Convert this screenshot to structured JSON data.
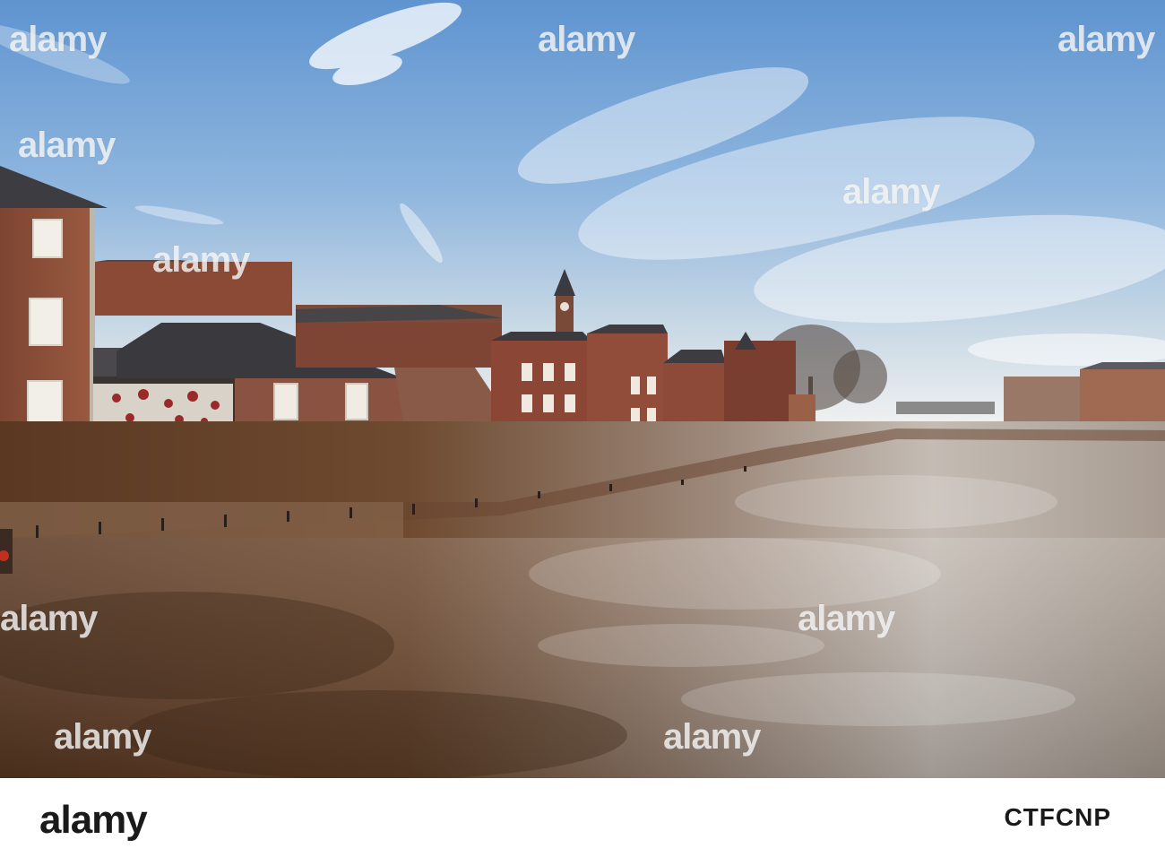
{
  "photo": {
    "subject": "flood-river-scene",
    "colors": {
      "sky_top": "#6f9fd4",
      "sky_bottom": "#e9eef2",
      "water_dark": "#5a3a22",
      "water_light": "#c9c5c2",
      "brick": "#8a4a34",
      "roof": "#3c3b3e"
    }
  },
  "watermark": {
    "text": "alamy"
  },
  "bottom_bar": {
    "logo_text": "alamy",
    "stock_id": "CTFCNP"
  }
}
